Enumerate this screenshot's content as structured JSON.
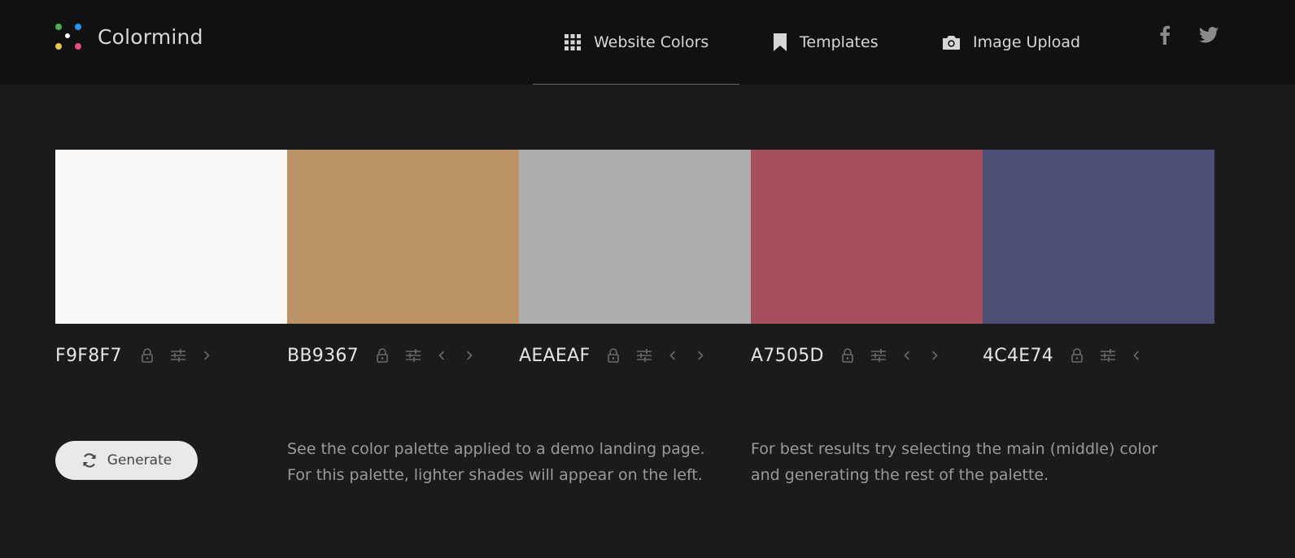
{
  "brand": {
    "name": "Colormind"
  },
  "nav": {
    "items": [
      {
        "label": "Website Colors",
        "icon": "grid-icon"
      },
      {
        "label": "Templates",
        "icon": "bookmark-icon"
      },
      {
        "label": "Image Upload",
        "icon": "camera-icon"
      }
    ],
    "active": "Website Colors",
    "social": [
      "facebook-icon",
      "twitter-icon"
    ]
  },
  "palette": [
    {
      "hex": "F9F8F7",
      "color": "#F9F8F7",
      "controls": [
        "lock-icon",
        "sliders-icon",
        "chevron-right-icon"
      ]
    },
    {
      "hex": "BB9367",
      "color": "#BB9367",
      "controls": [
        "lock-icon",
        "sliders-icon",
        "chevron-left-icon",
        "chevron-right-icon"
      ]
    },
    {
      "hex": "AEAEAF",
      "color": "#AEAEAF",
      "controls": [
        "lock-icon",
        "sliders-icon",
        "chevron-left-icon",
        "chevron-right-icon"
      ]
    },
    {
      "hex": "A7505D",
      "color": "#A7505D",
      "controls": [
        "lock-icon",
        "sliders-icon",
        "chevron-left-icon",
        "chevron-right-icon"
      ]
    },
    {
      "hex": "4C4E74",
      "color": "#4C4E74",
      "controls": [
        "lock-icon",
        "sliders-icon",
        "chevron-left-icon"
      ]
    }
  ],
  "actions": {
    "generate_label": "Generate"
  },
  "info": {
    "demo_line1": "See the color palette applied to a demo landing page.",
    "demo_line2": "For this palette, lighter shades will appear on the left.",
    "tip_line1": "For best results try selecting the main (middle) color",
    "tip_line2": "and generating the rest of the palette."
  },
  "colors": {
    "background": "#1b1b1b",
    "topbar": "#111111",
    "logo_dots": [
      "#4caf50",
      "#2196f3",
      "#e6c64a",
      "#e0507a"
    ]
  }
}
